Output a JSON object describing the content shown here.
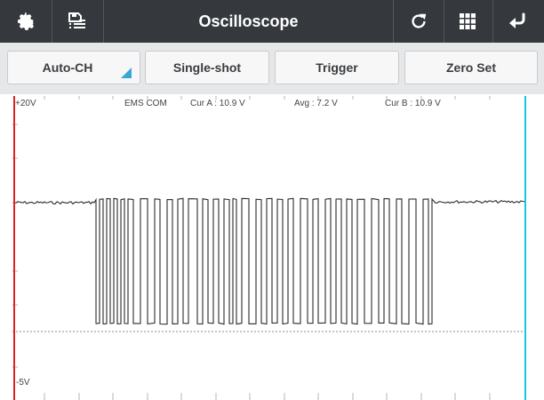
{
  "toolbar": {
    "title": "Oscilloscope",
    "icons": [
      "gear-icon",
      "save-list-icon",
      "refresh-icon",
      "grid-icon",
      "back-icon"
    ]
  },
  "controls": {
    "auto_ch_label": "Auto-CH",
    "single_shot_label": "Single-shot",
    "trigger_label": "Trigger",
    "zero_set_label": "Zero Set"
  },
  "scope": {
    "y_max_label": "+20V",
    "y_min_label": "-5V",
    "channel_label": "EMS COM",
    "cursor_a_label": "Cur A : 10.9 V",
    "average_label": "Avg : 7.2 V",
    "cursor_b_label": "Cur B : 10.9 V"
  },
  "colors": {
    "topbar": "#35393d",
    "cursor_a": "#e02020",
    "cursor_b": "#19c6e0",
    "accent": "#3aa6d6"
  }
}
